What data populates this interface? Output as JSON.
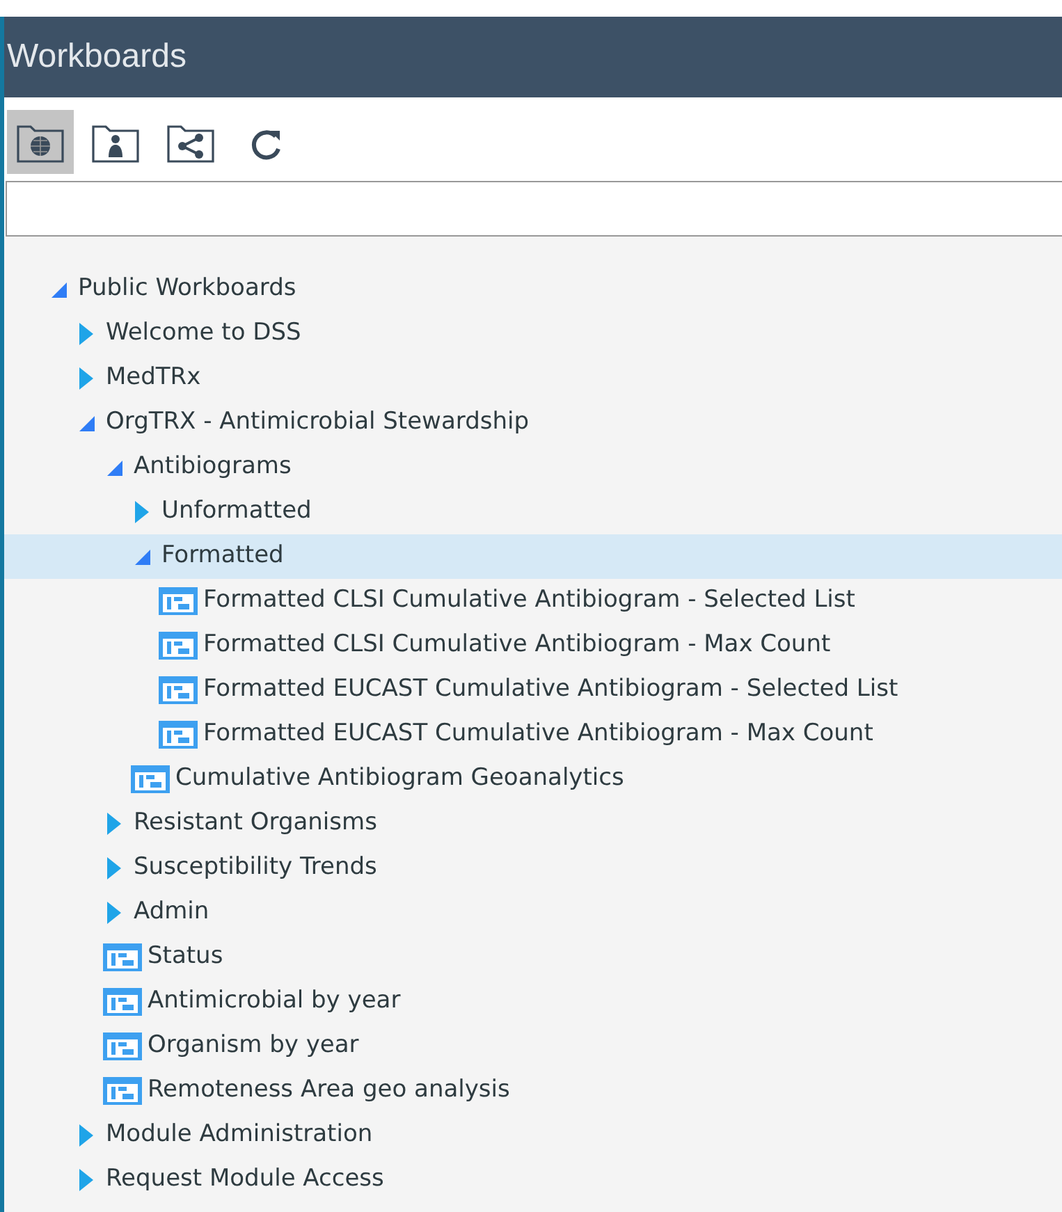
{
  "window": {
    "title": "Workboards"
  },
  "toolbar": [
    {
      "kind": "public",
      "selected": true
    },
    {
      "kind": "personal",
      "selected": false
    },
    {
      "kind": "shared",
      "selected": false
    },
    {
      "kind": "refresh",
      "selected": false
    }
  ],
  "tree": [
    {
      "kind": "folder",
      "label": "Public Workboards",
      "expanded": true,
      "selected": false,
      "children": [
        {
          "kind": "folder",
          "label": "Welcome to DSS",
          "expanded": false,
          "selected": false
        },
        {
          "kind": "folder",
          "label": "MedTRx",
          "expanded": false,
          "selected": false
        },
        {
          "kind": "folder",
          "label": "OrgTRX - Antimicrobial Stewardship",
          "expanded": true,
          "selected": false,
          "children": [
            {
              "kind": "folder",
              "label": "Antibiograms",
              "expanded": true,
              "selected": false,
              "children": [
                {
                  "kind": "folder",
                  "label": "Unformatted",
                  "expanded": false,
                  "selected": false
                },
                {
                  "kind": "folder",
                  "label": "Formatted",
                  "expanded": true,
                  "selected": true,
                  "children": [
                    {
                      "kind": "report",
                      "label": "Formatted CLSI Cumulative Antibiogram - Selected List",
                      "selected": false
                    },
                    {
                      "kind": "report",
                      "label": "Formatted CLSI Cumulative Antibiogram - Max Count",
                      "selected": false
                    },
                    {
                      "kind": "report",
                      "label": "Formatted EUCAST Cumulative Antibiogram - Selected List",
                      "selected": false
                    },
                    {
                      "kind": "report",
                      "label": "Formatted EUCAST Cumulative Antibiogram - Max Count",
                      "selected": false
                    }
                  ]
                },
                {
                  "kind": "report",
                  "label": "Cumulative Antibiogram Geoanalytics",
                  "selected": false
                }
              ]
            },
            {
              "kind": "folder",
              "label": "Resistant Organisms",
              "expanded": false,
              "selected": false
            },
            {
              "kind": "folder",
              "label": "Susceptibility Trends",
              "expanded": false,
              "selected": false
            },
            {
              "kind": "folder",
              "label": "Admin",
              "expanded": false,
              "selected": false
            },
            {
              "kind": "report",
              "label": "Status",
              "selected": false
            },
            {
              "kind": "report",
              "label": "Antimicrobial by year",
              "selected": false
            },
            {
              "kind": "report",
              "label": "Organism by year",
              "selected": false
            },
            {
              "kind": "report",
              "label": "Remoteness Area geo analysis",
              "selected": false
            }
          ]
        },
        {
          "kind": "folder",
          "label": "Module Administration",
          "expanded": false,
          "selected": false
        },
        {
          "kind": "folder",
          "label": "Request Module Access",
          "expanded": false,
          "selected": false
        }
      ]
    }
  ]
}
